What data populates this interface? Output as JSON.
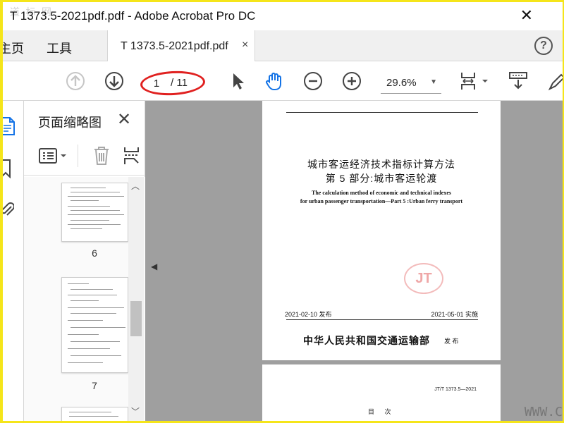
{
  "window": {
    "title": "T 1373.5-2021pdf.pdf - Adobe Acrobat Pro DC",
    "close_glyph": "✕",
    "watermark": "道 标 网"
  },
  "tabs": {
    "home": "主页",
    "tools": "工具",
    "doc": "T 1373.5-2021pdf.pdf",
    "doc_close": "×",
    "help": "?"
  },
  "toolbar": {
    "current_page": "1",
    "total_pages": "/ 11",
    "zoom": "29.6%",
    "icons": [
      "prev-page-icon",
      "next-page-icon",
      "select-pointer-icon",
      "hand-tool-icon",
      "zoom-out-icon",
      "zoom-in-icon",
      "page-fit-icon",
      "scroll-mode-icon"
    ]
  },
  "thumbnails": {
    "title": "页面缩略图",
    "close": "✕",
    "pages": [
      {
        "number": "6"
      },
      {
        "number": "7"
      }
    ]
  },
  "document": {
    "page1": {
      "title_line1": "城市客运经济技术指标计算方法",
      "title_line2": "第 5 部分:城市客运轮渡",
      "en_line1": "The calculation method of economic and technical indexes",
      "en_line2": "for urban passenger transportation—Part 5 :Urban ferry transport",
      "seal": "JT",
      "issue_date": "2021-02-10 发布",
      "effective_date": "2021-05-01 实施",
      "publisher": "中华人民共和国交通运输部",
      "publish_word": "发 布"
    },
    "page2": {
      "code": "JT/T 1373.5—2021",
      "toc": "目 次"
    },
    "corner_watermark": "WWW.C"
  },
  "colors": {
    "frame": "#f5e51a",
    "annotation_ring": "#e0201f",
    "accent_blue": "#1473e6",
    "canvas": "#9f9f9f"
  }
}
